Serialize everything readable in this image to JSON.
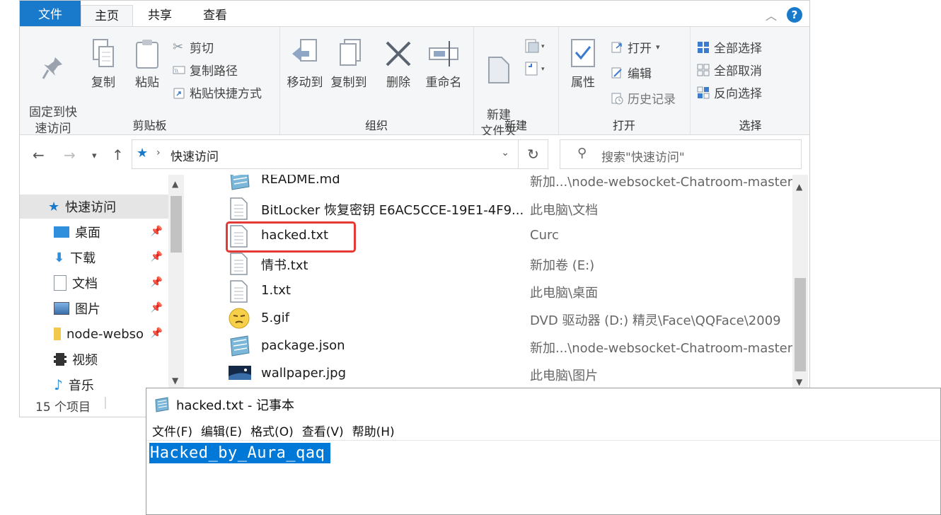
{
  "ribbon_tabs": {
    "file": "文件",
    "home": "主页",
    "share": "共享",
    "view": "查看"
  },
  "clipboard": {
    "pin_quick_access": "固定到快\n速访问",
    "copy": "复制",
    "paste": "粘贴",
    "cut": "剪切",
    "copy_path": "复制路径",
    "paste_shortcut": "粘贴快捷方式",
    "label": "剪贴板"
  },
  "organize": {
    "move_to": "移动到",
    "copy_to": "复制到",
    "delete": "删除",
    "rename": "重命名",
    "label": "组织"
  },
  "new_group": {
    "new_folder": "新建\n文件夹",
    "label": "新建"
  },
  "open_group": {
    "properties": "属性",
    "open": "打开",
    "edit": "编辑",
    "history": "历史记录",
    "label": "打开"
  },
  "select_group": {
    "select_all": "全部选择",
    "select_none": "全部取消",
    "invert": "反向选择",
    "label": "选择"
  },
  "address": {
    "path": "快速访问",
    "search_placeholder": "搜索\"快速访问\""
  },
  "nav_pane": {
    "items": [
      {
        "label": "快速访问",
        "icon": "star-icon"
      },
      {
        "label": "桌面",
        "icon": "desktop-icon"
      },
      {
        "label": "下载",
        "icon": "download-icon"
      },
      {
        "label": "文档",
        "icon": "documents-icon"
      },
      {
        "label": "图片",
        "icon": "pictures-icon"
      },
      {
        "label": "node-webso",
        "icon": "folder-icon"
      },
      {
        "label": "视频",
        "icon": "video-icon"
      },
      {
        "label": "音乐",
        "icon": "music-icon"
      }
    ]
  },
  "files": [
    {
      "name": "README.md",
      "location": "新加...\\node-websocket-Chatroom-master",
      "icon": "notepad-file-icon"
    },
    {
      "name": "BitLocker 恢复密钥 E6AC5CCE-19E1-4F9...",
      "location": "此电脑\\文档",
      "icon": "text-file-icon"
    },
    {
      "name": "hacked.txt",
      "location": "Curc",
      "icon": "text-file-icon"
    },
    {
      "name": "情书.txt",
      "location": "新加卷 (E:)",
      "icon": "text-file-icon"
    },
    {
      "name": "1.txt",
      "location": "此电脑\\桌面",
      "icon": "text-file-icon"
    },
    {
      "name": "5.gif",
      "location": "DVD 驱动器 (D:) 精灵\\Face\\QQFace\\2009",
      "icon": "emoji-gif-icon"
    },
    {
      "name": "package.json",
      "location": "新加...\\node-websocket-Chatroom-master",
      "icon": "notepad-file-icon"
    },
    {
      "name": "wallpaper.jpg",
      "location": "此电脑\\图片",
      "icon": "image-file-icon"
    }
  ],
  "status": {
    "count": "15 个项目"
  },
  "notepad": {
    "title": "hacked.txt - 记事本",
    "menu": [
      "文件(F)",
      "编辑(E)",
      "格式(O)",
      "查看(V)",
      "帮助(H)"
    ],
    "content": "Hacked_by_Aura_qaq"
  },
  "colors": {
    "accent": "#1979ca",
    "selection": "#0078d7",
    "highlight_box": "#e53935"
  }
}
